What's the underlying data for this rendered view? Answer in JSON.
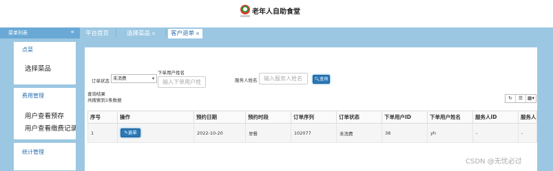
{
  "header": {
    "title": "老年人自助食堂"
  },
  "sidebar": {
    "title": "菜单列表",
    "collapse_icon": "«",
    "groups": [
      {
        "title": "点菜",
        "items": [
          "选择菜品"
        ]
      },
      {
        "title": "费用管理",
        "items": [
          "用户查看预存",
          "用户查看缴费记录"
        ]
      },
      {
        "title": "统计管理"
      }
    ]
  },
  "tabs": [
    {
      "label": "平台首页"
    },
    {
      "label": "选择菜品",
      "close": "×"
    },
    {
      "label": "客户退单",
      "close": "×"
    }
  ],
  "filters": {
    "status_label": "订单状态",
    "status_value": "未消费",
    "username_label": "下单用户姓名",
    "username_placeholder": "输入下单用户姓",
    "servicer_label": "服务人姓名",
    "servicer_placeholder": "输入服务人姓名",
    "search_button": "查询"
  },
  "results": {
    "title": "查询结果",
    "summary": "共搜索到1条数据"
  },
  "table": {
    "columns": [
      "序号",
      "操作",
      "预约日期",
      "预约时段",
      "订单序列",
      "订单状态",
      "下单用户ID",
      "下单用户姓名",
      "服务人ID",
      "服务人"
    ],
    "rows": [
      [
        "1",
        "退单",
        "2022-10-20",
        "早餐",
        "102077",
        "未消费",
        "38",
        "yh",
        "-",
        "-"
      ]
    ]
  },
  "toolbar": {
    "icons": [
      "refresh-icon",
      "list-icon",
      "grid-icon"
    ],
    "glyphs": [
      "↻",
      "☰",
      "▦▾"
    ]
  },
  "watermark": "CSDN @无忧必过",
  "colors": {
    "accent": "#2b78b6",
    "sidebar_bg": "#9bc7e2",
    "header_blue": "#6aa9d5"
  }
}
